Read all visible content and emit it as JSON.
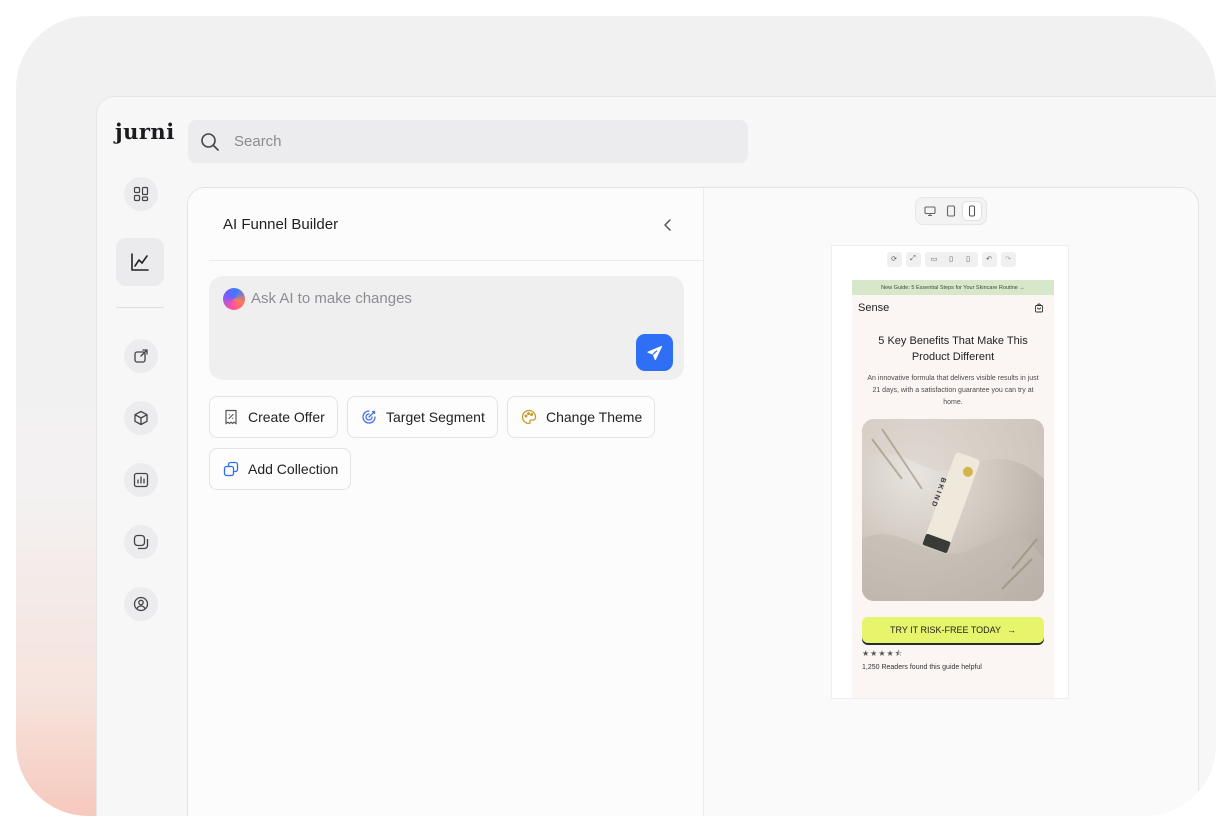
{
  "app": {
    "logo": "jurni"
  },
  "search": {
    "placeholder": "Search"
  },
  "sidebar": {
    "items": [
      {
        "name": "dashboard",
        "icon": "grid-icon"
      },
      {
        "name": "analytics",
        "icon": "chart-line-icon",
        "active": true
      },
      {
        "name": "external",
        "icon": "external-link-icon"
      },
      {
        "name": "products",
        "icon": "cube-icon"
      },
      {
        "name": "reports",
        "icon": "bar-chart-icon"
      },
      {
        "name": "content",
        "icon": "layers-icon"
      },
      {
        "name": "profile",
        "icon": "user-circle-icon"
      }
    ]
  },
  "builder": {
    "title": "AI Funnel Builder",
    "ai_placeholder": "Ask AI to make changes",
    "chips": [
      {
        "label": "Create Offer",
        "icon": "offer-tag-icon"
      },
      {
        "label": "Target Segment",
        "icon": "target-icon"
      },
      {
        "label": "Change Theme",
        "icon": "palette-icon"
      },
      {
        "label": "Add Collection",
        "icon": "collection-icon"
      }
    ]
  },
  "preview": {
    "banner": "New Guide: 5 Essential Steps for Your Skincare Routine →",
    "brand": "Sense",
    "title": "5 Key Benefits That Make This Product Different",
    "subtitle": "An innovative formula that delivers visible results in just 21 days, with a satisfaction guarantee you can try at home.",
    "product_label": "BKIND",
    "cta": "TRY IT RISK-FREE TODAY",
    "rating": "★★★★⯪",
    "social_proof": "1,250 Readers found this guide helpful"
  },
  "colors": {
    "accent": "#2f6ff5",
    "cta": "#e6f56b",
    "banner": "#d7e7c9"
  }
}
